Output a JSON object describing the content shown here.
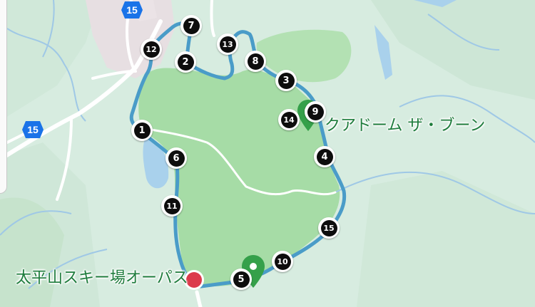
{
  "map": {
    "route_color": "#4a9cc8",
    "park_color": "#a6dca6",
    "pin_color": "#35a04a",
    "start_marker_color": "#dc3a4c",
    "shield_color": "#1a73e8"
  },
  "roads": {
    "shield_top": "15",
    "shield_left": "15"
  },
  "places": {
    "dome": "クアドーム ザ・ブーン",
    "ski": "太平山スキー場オーパス"
  },
  "waypoints": [
    "1",
    "2",
    "3",
    "4",
    "5",
    "6",
    "7",
    "8",
    "9",
    "10",
    "11",
    "12",
    "13",
    "14",
    "15"
  ]
}
